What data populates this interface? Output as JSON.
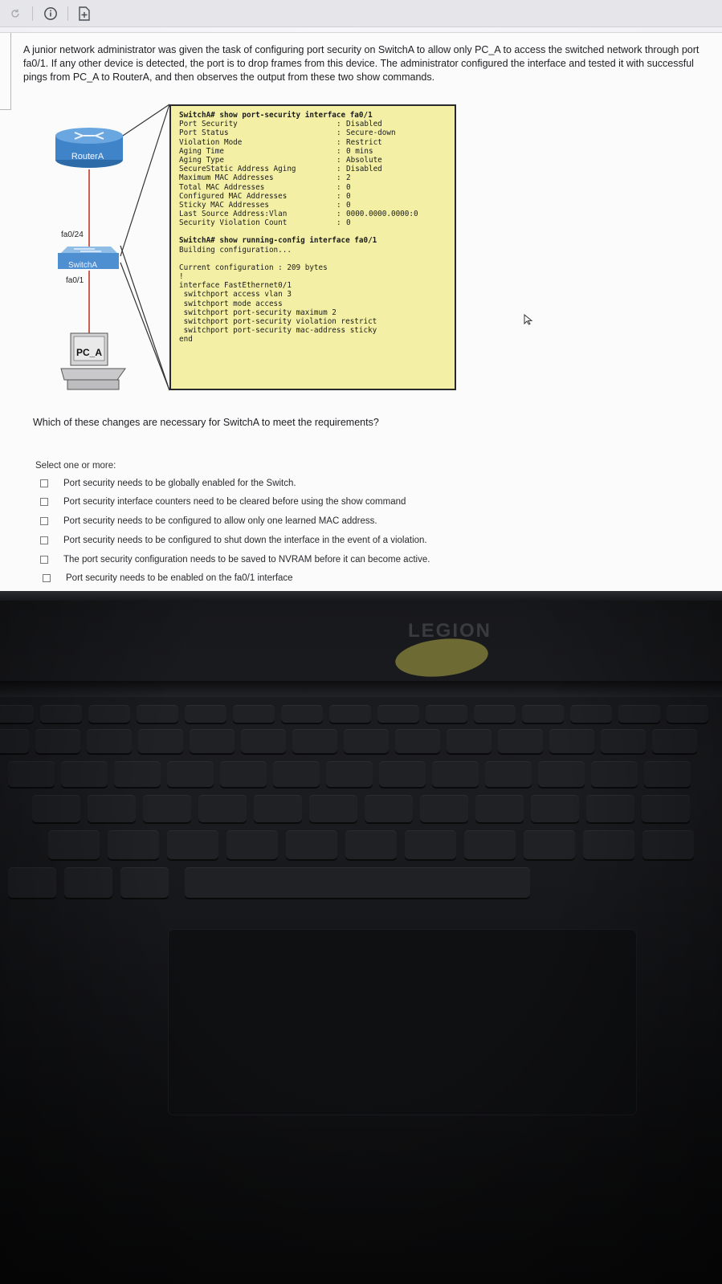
{
  "browser_bar": {
    "icons": [
      "refresh-icon",
      "info-icon",
      "add-note-icon"
    ]
  },
  "question": {
    "text": "A junior network administrator was given the task of configuring port security on SwitchA to allow only PC_A to access the switched network through port fa0/1. If any other device is detected, the port is to drop frames from this device. The administrator configured the interface and tested it with successful pings from PC_A to RouterA, and then observes the output from these two show commands.",
    "prompt": "Which of these changes are necessary for SwitchA to meet the requirements?",
    "select_label": "Select one or more:",
    "options": [
      "Port security needs to be globally enabled for the Switch.",
      "Port security interface counters need to be cleared before using the show command",
      "Port security needs to be configured to allow only one learned MAC address.",
      "Port security needs to be configured to shut down the interface in the event of a violation.",
      "The port security configuration needs to be saved to NVRAM before it can become active.",
      "Port security needs to be enabled on the fa0/1 interface"
    ]
  },
  "topology": {
    "router": "RouterA",
    "router_port": "fa0/24",
    "switch": "SwitchA",
    "switch_port": "fa0/1",
    "pc": "PC_A"
  },
  "console": {
    "command1": "SwitchA# show port-security interface fa0/1",
    "rows": [
      {
        "key": "Port Security",
        "value": "Disabled"
      },
      {
        "key": "Port Status",
        "value": "Secure-down"
      },
      {
        "key": "Violation Mode",
        "value": "Restrict"
      },
      {
        "key": "Aging Time",
        "value": "0 mins"
      },
      {
        "key": "Aging Type",
        "value": "Absolute"
      },
      {
        "key": "SecureStatic Address Aging",
        "value": "Disabled"
      },
      {
        "key": "Maximum MAC Addresses",
        "value": "2"
      },
      {
        "key": "Total MAC Addresses",
        "value": "0"
      },
      {
        "key": "Configured MAC Addresses",
        "value": "0"
      },
      {
        "key": "Sticky MAC Addresses",
        "value": "0"
      },
      {
        "key": "Last Source Address:Vlan",
        "value": "0000.0000.0000:0"
      },
      {
        "key": "Security Violation Count",
        "value": "0"
      }
    ],
    "command2": "SwitchA# show running-config interface fa0/1",
    "building": "Building configuration...",
    "current": "Current configuration : 209 bytes",
    "bang": "!",
    "config_lines": [
      "interface FastEthernet0/1",
      " switchport access vlan 3",
      " switchport mode access",
      " switchport port-security maximum 2",
      " switchport port-security violation restrict",
      " switchport port-security mac-address sticky",
      "end"
    ]
  },
  "laptop": {
    "logo": "LEGION"
  },
  "colors": {
    "console_bg": "#f3f0a6",
    "router_blue": "#3f83c9",
    "link_red": "#c0392b"
  }
}
